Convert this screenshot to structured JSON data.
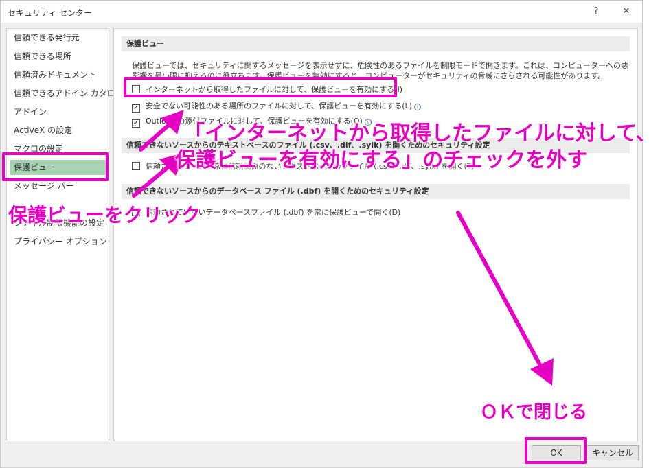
{
  "window": {
    "title": "セキュリティ センター",
    "help_glyph": "?",
    "close_glyph": "✕"
  },
  "sidebar": {
    "items": [
      {
        "label": "信頼できる発行元"
      },
      {
        "label": "信頼できる場所"
      },
      {
        "label": "信頼済みドキュメント"
      },
      {
        "label": "信頼できるアドイン カタログ"
      },
      {
        "label": "アドイン"
      },
      {
        "label": "ActiveX の設定"
      },
      {
        "label": "マクロの設定"
      },
      {
        "label": "保護ビュー"
      },
      {
        "label": "メッセージ バー"
      },
      {
        "label": "ファイル制限機能の設定"
      },
      {
        "label": "プライバシー オプション"
      }
    ],
    "selected": "保護ビュー"
  },
  "content": {
    "section1": {
      "header": "保護ビュー",
      "description": "保護ビューでは、セキュリティに関するメッセージを表示せずに、危険性のあるファイルを制限モードで開きます。これは、コンピューターへの悪影響を最小限に抑えるのに役立ちます。保護ビューを無効にすると、コンピューターがセキュリティの脅威にさらされる可能性があります。",
      "options": [
        {
          "label": "インターネットから取得したファイルに対して、保護ビューを有効にする(I)",
          "checked": false
        },
        {
          "label": "安全でない可能性のある場所のファイルに対して、保護ビューを有効にする(L)",
          "checked": true
        },
        {
          "label": "Outlook の添付ファイルに対して、保護ビューを有効にする(O)",
          "checked": true
        }
      ]
    },
    "section2": {
      "header": "信頼できないソースからのテキストベースのファイル (.csv、.dif、.sylk) を開くためのセキュリティ設定",
      "option": {
        "label": "信頼されたソースや常に信頼関係のないテキストベースのファイル (.csv、.dif、.sylk) を開く(T)",
        "checked": false
      }
    },
    "section3": {
      "header": "信頼できないソースからのデータベース ファイル (.dbf) を開くためのセキュリティ設定",
      "option": {
        "label": "信頼されていないデータベースファイル (.dbf) を常に保護ビューで開く(D)",
        "checked": false
      }
    }
  },
  "buttons": {
    "ok": "OK",
    "cancel": "キャンセル"
  },
  "annotations": {
    "uncheck_line1": "「インターネットから取得したファイルに対して、",
    "uncheck_line2": "保護ビューを有効にする」のチェックを外す",
    "click_protected_view": "保護ビューをクリック",
    "close_with_ok": "ＯＫで閉じる",
    "color": "#e600c3"
  }
}
